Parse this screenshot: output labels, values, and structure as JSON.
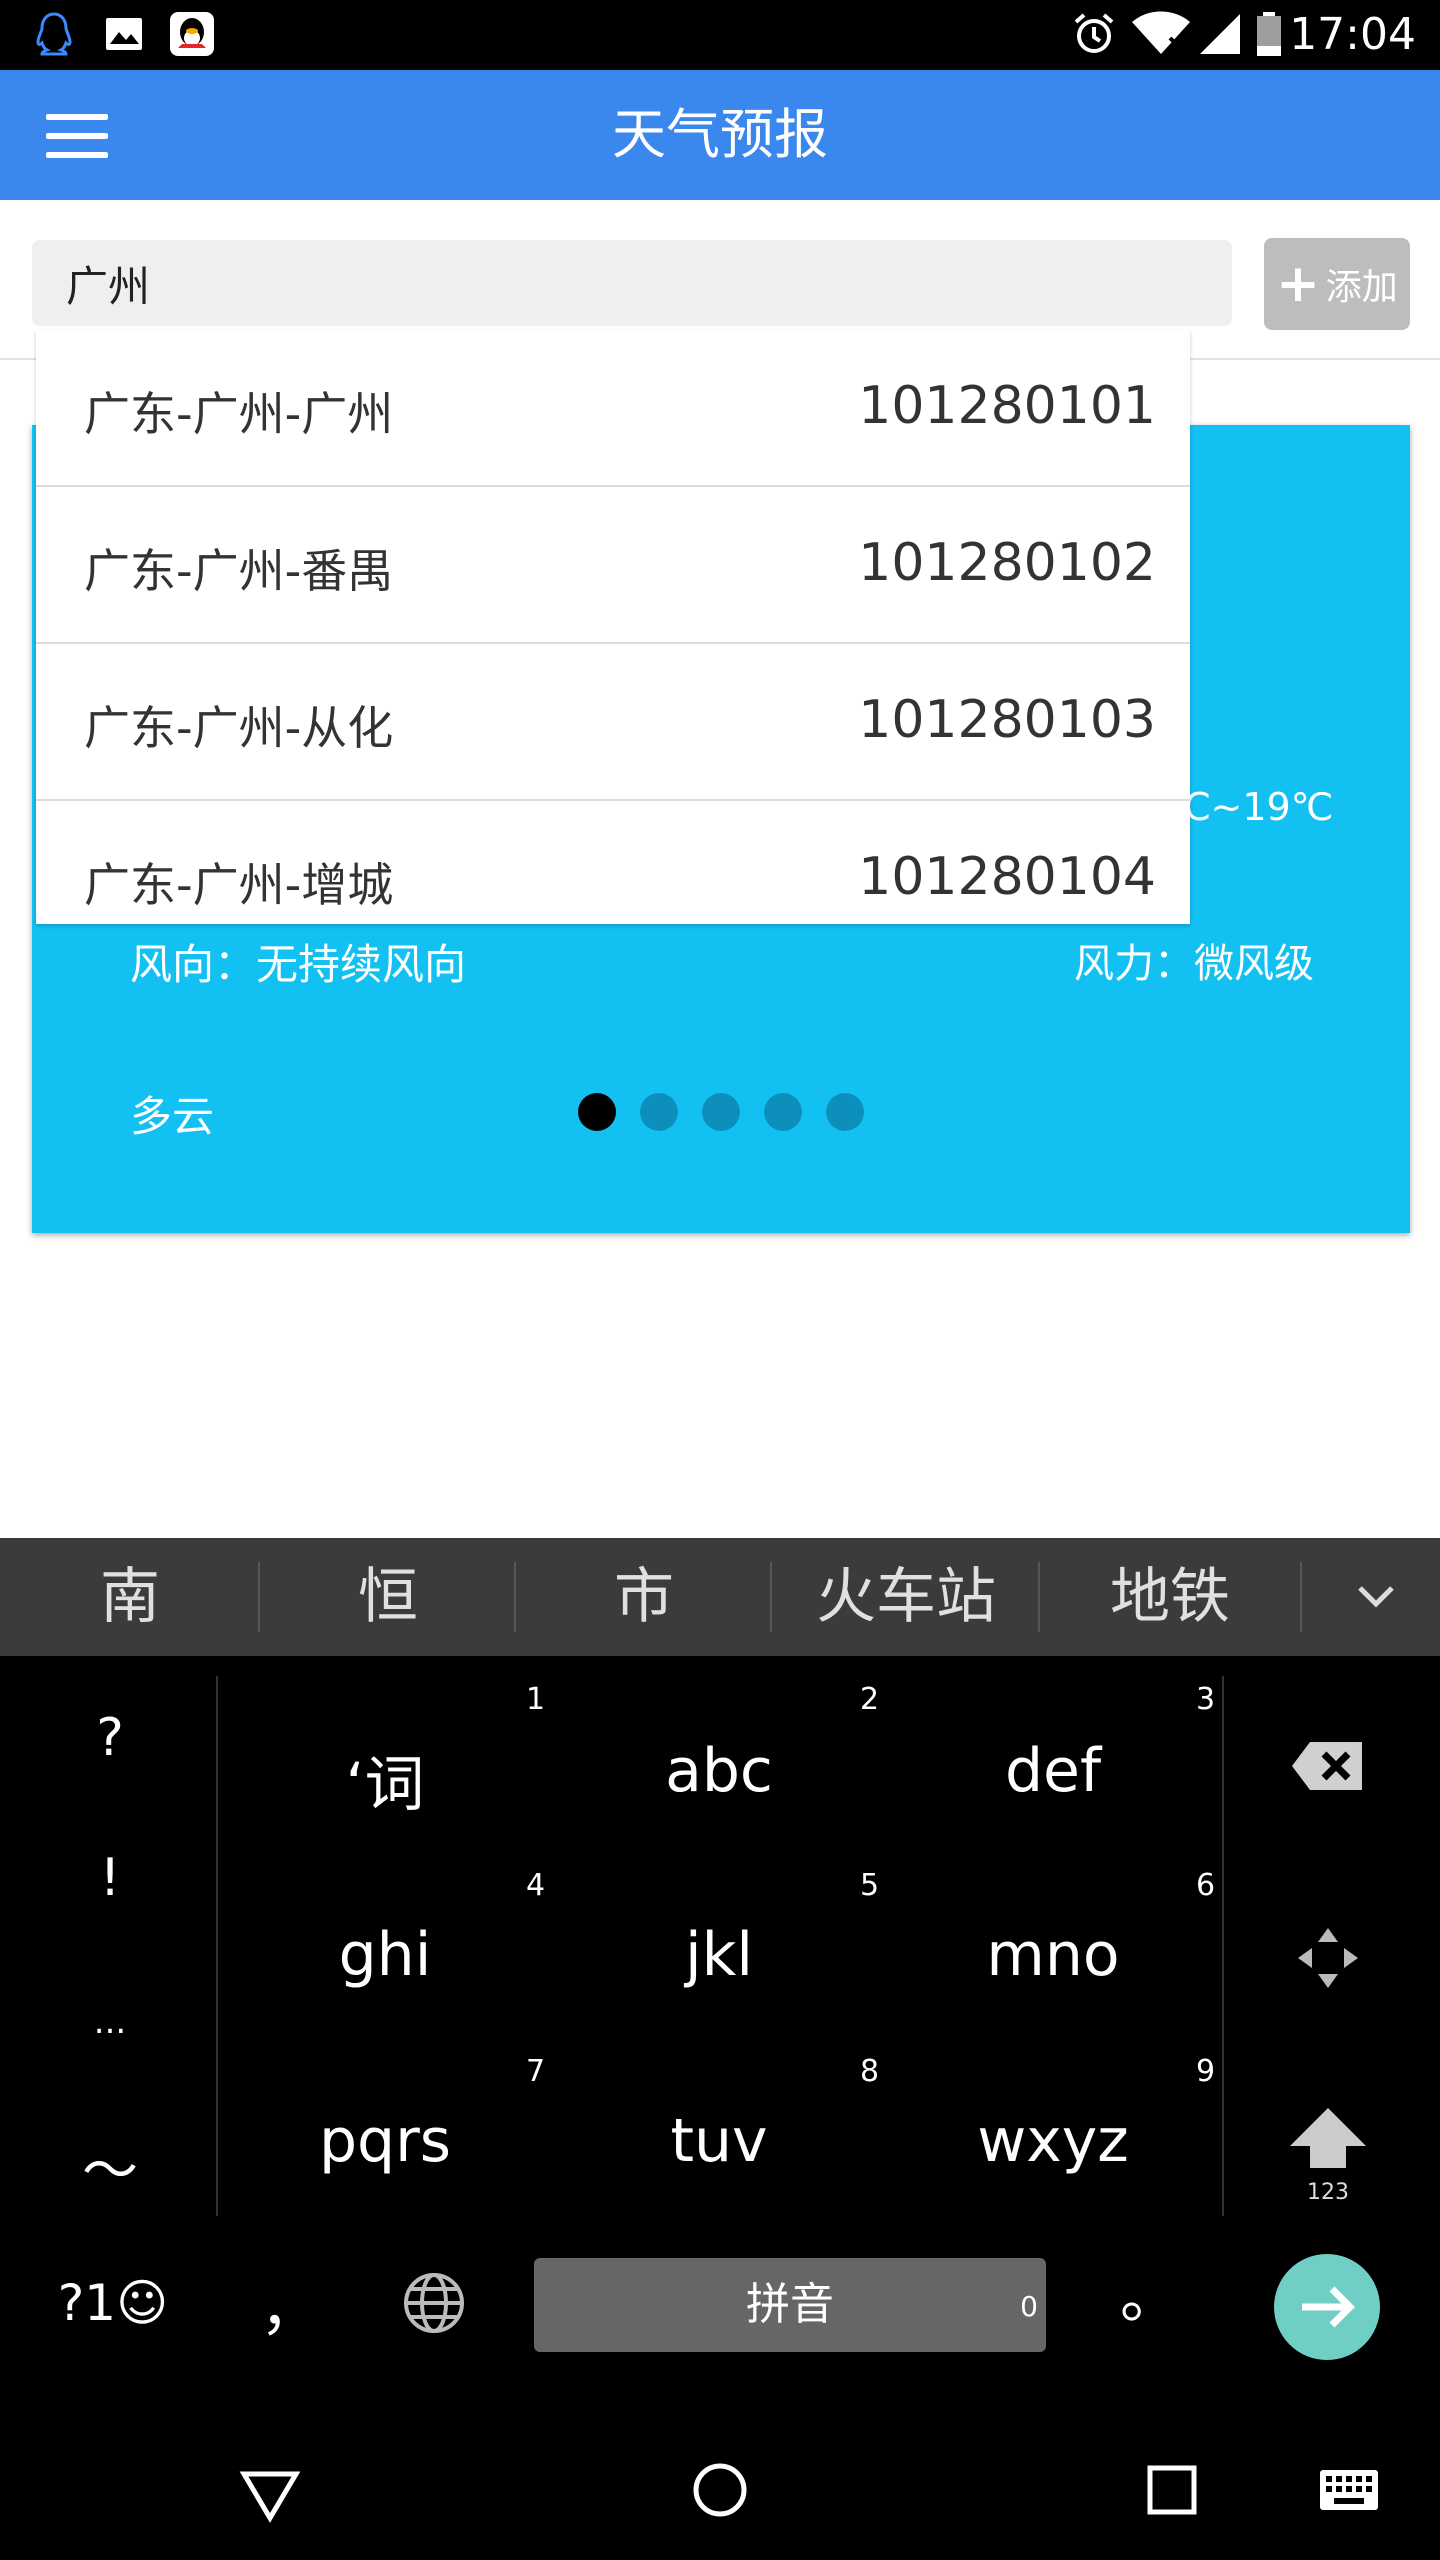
{
  "status_bar": {
    "time": "17:04",
    "left_icons": [
      "qq-outline-icon",
      "image-icon",
      "qq-penguin-icon"
    ],
    "right_icons": [
      "alarm-icon",
      "wifi-icon",
      "signal-icon",
      "battery-icon"
    ]
  },
  "toolbar": {
    "title": "天气预报"
  },
  "search": {
    "value": "广州"
  },
  "add_button": {
    "label": "添加"
  },
  "suggestions": [
    {
      "name": "广东-广州-广州",
      "code": "101280101"
    },
    {
      "name": "广东-广州-番禺",
      "code": "101280102"
    },
    {
      "name": "广东-广州-从化",
      "code": "101280103"
    },
    {
      "name": "广东-广州-增城",
      "code": "101280104"
    }
  ],
  "weather_card": {
    "temperature_partial": "C~19℃",
    "wind_direction": "风向：无持续风向",
    "wind_force": "风力：微风级",
    "condition": "多云",
    "pager_total": 5,
    "pager_active": 1,
    "color": "#13c0f2"
  },
  "candidates": [
    "南",
    "恒",
    "市",
    "火车站",
    "地铁"
  ],
  "keyboard": {
    "left_symbols": [
      "?",
      "!",
      "...",
      "～"
    ],
    "keys": [
      {
        "num": "1",
        "label": "‘词"
      },
      {
        "num": "2",
        "label": "abc"
      },
      {
        "num": "3",
        "label": "def"
      },
      {
        "num": "4",
        "label": "ghi"
      },
      {
        "num": "5",
        "label": "jkl"
      },
      {
        "num": "6",
        "label": "mno"
      },
      {
        "num": "7",
        "label": "pqrs"
      },
      {
        "num": "8",
        "label": "tuv"
      },
      {
        "num": "9",
        "label": "wxyz"
      }
    ],
    "shift_sub": "123",
    "bottom": {
      "symbols_key": "?1☺",
      "comma": "，",
      "space": "拼音",
      "space_num": "0",
      "period": "。"
    },
    "right_icons": [
      "backspace-icon",
      "cursor-move-icon",
      "shift-icon",
      "enter-icon"
    ]
  },
  "nav_bar": {
    "icons": [
      "back-icon",
      "home-icon",
      "recents-icon",
      "keyboard-icon"
    ]
  },
  "colors": {
    "toolbar": "#3a87ed",
    "card": "#13c0f2",
    "enter": "#6fcfc4"
  }
}
